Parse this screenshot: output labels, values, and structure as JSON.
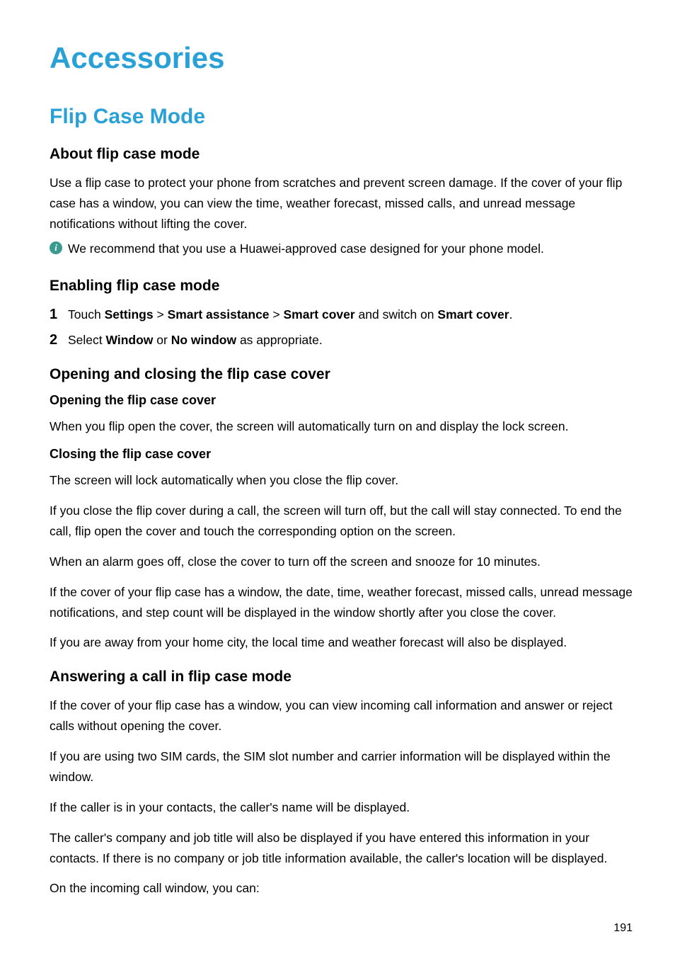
{
  "title": "Accessories",
  "section_flip": {
    "heading": "Flip Case Mode",
    "about": {
      "heading": "About flip case mode",
      "para": "Use a flip case to protect your phone from scratches and prevent screen damage. If the cover of your flip case has a window, you can view the time, weather forecast, missed calls, and unread message notifications without lifting the cover.",
      "note_icon_glyph": "i",
      "note_text": "We recommend that you use a Huawei-approved case designed for your phone model."
    },
    "enabling": {
      "heading": "Enabling flip case mode",
      "steps": [
        {
          "num": "1",
          "pre": "Touch ",
          "b1": "Settings",
          "mid1": " > ",
          "b2": "Smart assistance",
          "mid2": " > ",
          "b3": "Smart cover",
          "mid3": " and switch on ",
          "b4": "Smart cover",
          "post": "."
        },
        {
          "num": "2",
          "pre": "Select ",
          "b1": "Window",
          "mid1": " or ",
          "b2": "No window",
          "post": " as appropriate."
        }
      ]
    },
    "open_close": {
      "heading": "Opening and closing the flip case cover",
      "opening": {
        "heading": "Opening the flip case cover",
        "para": "When you flip open the cover, the screen will automatically turn on and display the lock screen."
      },
      "closing": {
        "heading": "Closing the flip case cover",
        "p1": "The screen will lock automatically when you close the flip cover.",
        "p2": "If you close the flip cover during a call, the screen will turn off, but the call will stay connected. To end the call, flip open the cover and touch the corresponding option on the screen.",
        "p3": "When an alarm goes off, close the cover to turn off the screen and snooze for 10 minutes.",
        "p4": "If the cover of your flip case has a window, the date, time, weather forecast, missed calls, unread message notifications, and step count will be displayed in the window shortly after you close the cover.",
        "p5": "If you are away from your home city, the local time and weather forecast will also be displayed."
      }
    },
    "answering": {
      "heading": "Answering a call in flip case mode",
      "p1": "If the cover of your flip case has a window, you can view incoming call information and answer or reject calls without opening the cover.",
      "p2": "If you are using two SIM cards, the SIM slot number and carrier information will be displayed within the window.",
      "p3": "If the caller is in your contacts, the caller's name will be displayed.",
      "p4": "The caller's company and job title will also be displayed if you have entered this information in your contacts. If there is no company or job title information available, the caller's location will be displayed.",
      "p5": "On the incoming call window, you can:"
    }
  },
  "page_number": "191"
}
